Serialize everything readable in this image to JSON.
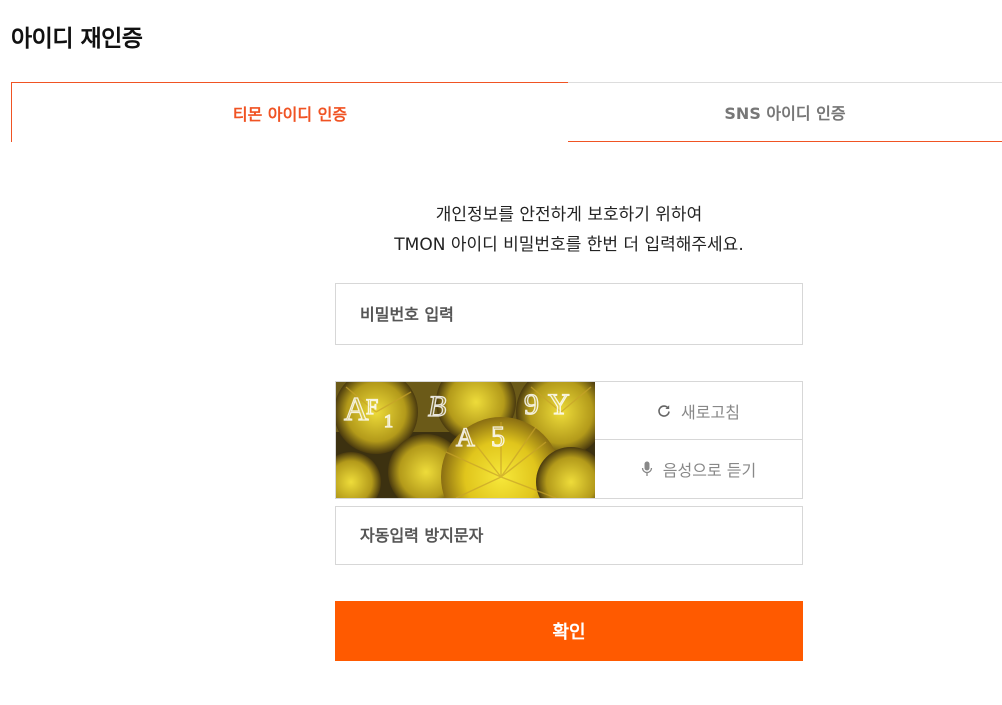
{
  "page": {
    "title": "아이디 재인증"
  },
  "tabs": [
    {
      "label": "티몬 아이디 인증",
      "active": true
    },
    {
      "label": "SNS 아이디 인증",
      "active": false
    }
  ],
  "intro": {
    "line1": "개인정보를 안전하게 보호하기 위하여",
    "line2": "TMON 아이디 비밀번호를 한번 더 입력해주세요."
  },
  "password": {
    "placeholder": "비밀번호 입력",
    "value": ""
  },
  "captcha": {
    "image_text": "AF1BA5 9Y",
    "refresh_label": "새로고침",
    "refresh_icon": "refresh-icon",
    "audio_label": "음성으로 듣기",
    "audio_icon": "microphone-icon",
    "input_placeholder": "자동입력 방지문자",
    "input_value": ""
  },
  "confirm": {
    "label": "확인"
  },
  "colors": {
    "accent": "#f05323",
    "button": "#ff5a00",
    "border": "#d7d7d7"
  }
}
